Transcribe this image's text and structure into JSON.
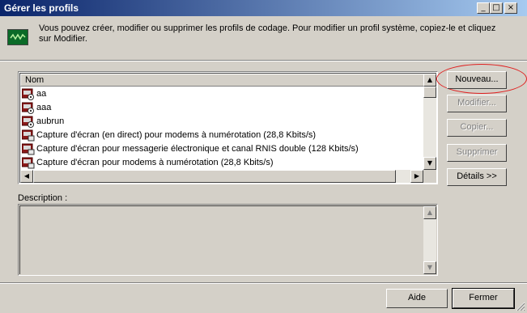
{
  "window": {
    "title": "Gérer les profils",
    "controls": {
      "minimize": "_",
      "maximize": "□",
      "close": "×"
    }
  },
  "header": {
    "description": "Vous pouvez créer, modifier ou supprimer les profils de codage. Pour modifier un profil système, copiez-le et cliquez sur Modifier.",
    "icon": "profile-manager-icon"
  },
  "profile_list": {
    "column_header": "Nom",
    "rows": [
      {
        "label": "aa",
        "icon": "user-profile-icon"
      },
      {
        "label": "aaa",
        "icon": "user-profile-icon"
      },
      {
        "label": "aubrun",
        "icon": "user-profile-icon"
      },
      {
        "label": "Capture d'écran (en direct) pour modems à numérotation (28,8 Kbits/s)",
        "icon": "system-profile-icon"
      },
      {
        "label": "Capture d'écran pour messagerie électronique et canal RNIS double (128 Kbits/s)",
        "icon": "system-profile-icon"
      },
      {
        "label": "Capture d'écran pour modems à numérotation (28,8 Kbits/s)",
        "icon": "system-profile-icon"
      }
    ]
  },
  "side_buttons": {
    "new": "Nouveau...",
    "edit": "Modifier...",
    "copy": "Copier...",
    "delete": "Supprimer",
    "details": "Détails >>"
  },
  "description_section": {
    "label": "Description :",
    "value": ""
  },
  "footer": {
    "help": "Aide",
    "close": "Fermer"
  },
  "colors": {
    "titlebar_start": "#0a246a",
    "titlebar_end": "#a6caf0",
    "face": "#d4d0c8",
    "highlight_ellipse": "#e02020"
  }
}
